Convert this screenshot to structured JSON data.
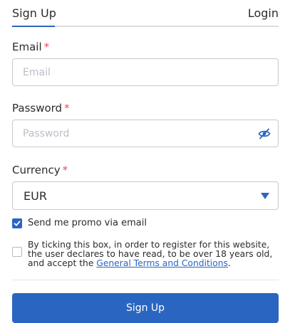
{
  "tabs": {
    "signup_label": "Sign Up",
    "login_label": "Login",
    "active": "Sign Up"
  },
  "form": {
    "email_label": "Email",
    "email_placeholder": "Email",
    "email_value": "",
    "password_label": "Password",
    "password_placeholder": "Password",
    "password_value": "",
    "password_toggle_icon": "eye-slash-icon",
    "currency_label": "Currency",
    "currency_value": "EUR",
    "required_marker": "*"
  },
  "promo": {
    "label": "Send me promo via email",
    "checked": true
  },
  "terms": {
    "text_before": "By ticking this box, in order to register for this website, the user declares to have read, to be over 18 years old, and accept the ",
    "link_text": "General Terms and Conditions",
    "text_after": ".",
    "checked": false
  },
  "submit_label": "Sign Up",
  "colors": {
    "accent": "#2a66c1",
    "required": "#e05060",
    "border": "#c9c9c9"
  }
}
